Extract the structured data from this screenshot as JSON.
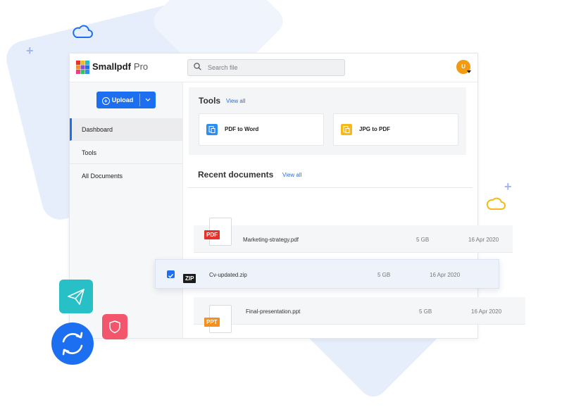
{
  "app": {
    "brand": "Smallpdf",
    "plan": "Pro",
    "avatar_initial": "U"
  },
  "search": {
    "placeholder": "Search file"
  },
  "sidebar": {
    "upload_label": "Upload",
    "items": [
      {
        "label": "Dashboard",
        "active": true
      },
      {
        "label": "Tools",
        "active": false
      },
      {
        "label": "All Documents",
        "active": false
      }
    ]
  },
  "tools": {
    "title": "Tools",
    "view_all": "View all",
    "cards": [
      {
        "label": "PDF to Word",
        "icon": "pdf-to-word-icon",
        "color": "#2f8df0"
      },
      {
        "label": "JPG to PDF",
        "icon": "jpg-to-pdf-icon",
        "color": "#f6b91a"
      }
    ]
  },
  "recent": {
    "title": "Recent documents",
    "view_all": "View all",
    "rows": [
      {
        "tag": "PDF",
        "name": "Marketing-strategy.pdf",
        "size": "5 GB",
        "date": "16 Apr 2020",
        "color": "#e5322d"
      },
      {
        "tag": "ZIP",
        "name": "Cv-updated.zip",
        "size": "5 GB",
        "date": "16 Apr 2020",
        "color": "#1c1c1c",
        "selected": true
      },
      {
        "tag": "PPT",
        "name": "Final-presentation.ppt",
        "size": "5 GB",
        "date": "16 Apr 2020",
        "color": "#f5901e"
      }
    ]
  },
  "colors": {
    "accent": "#1d6ff2",
    "teal": "#28c0c7",
    "coral": "#f3566c",
    "orange": "#f29a12"
  }
}
